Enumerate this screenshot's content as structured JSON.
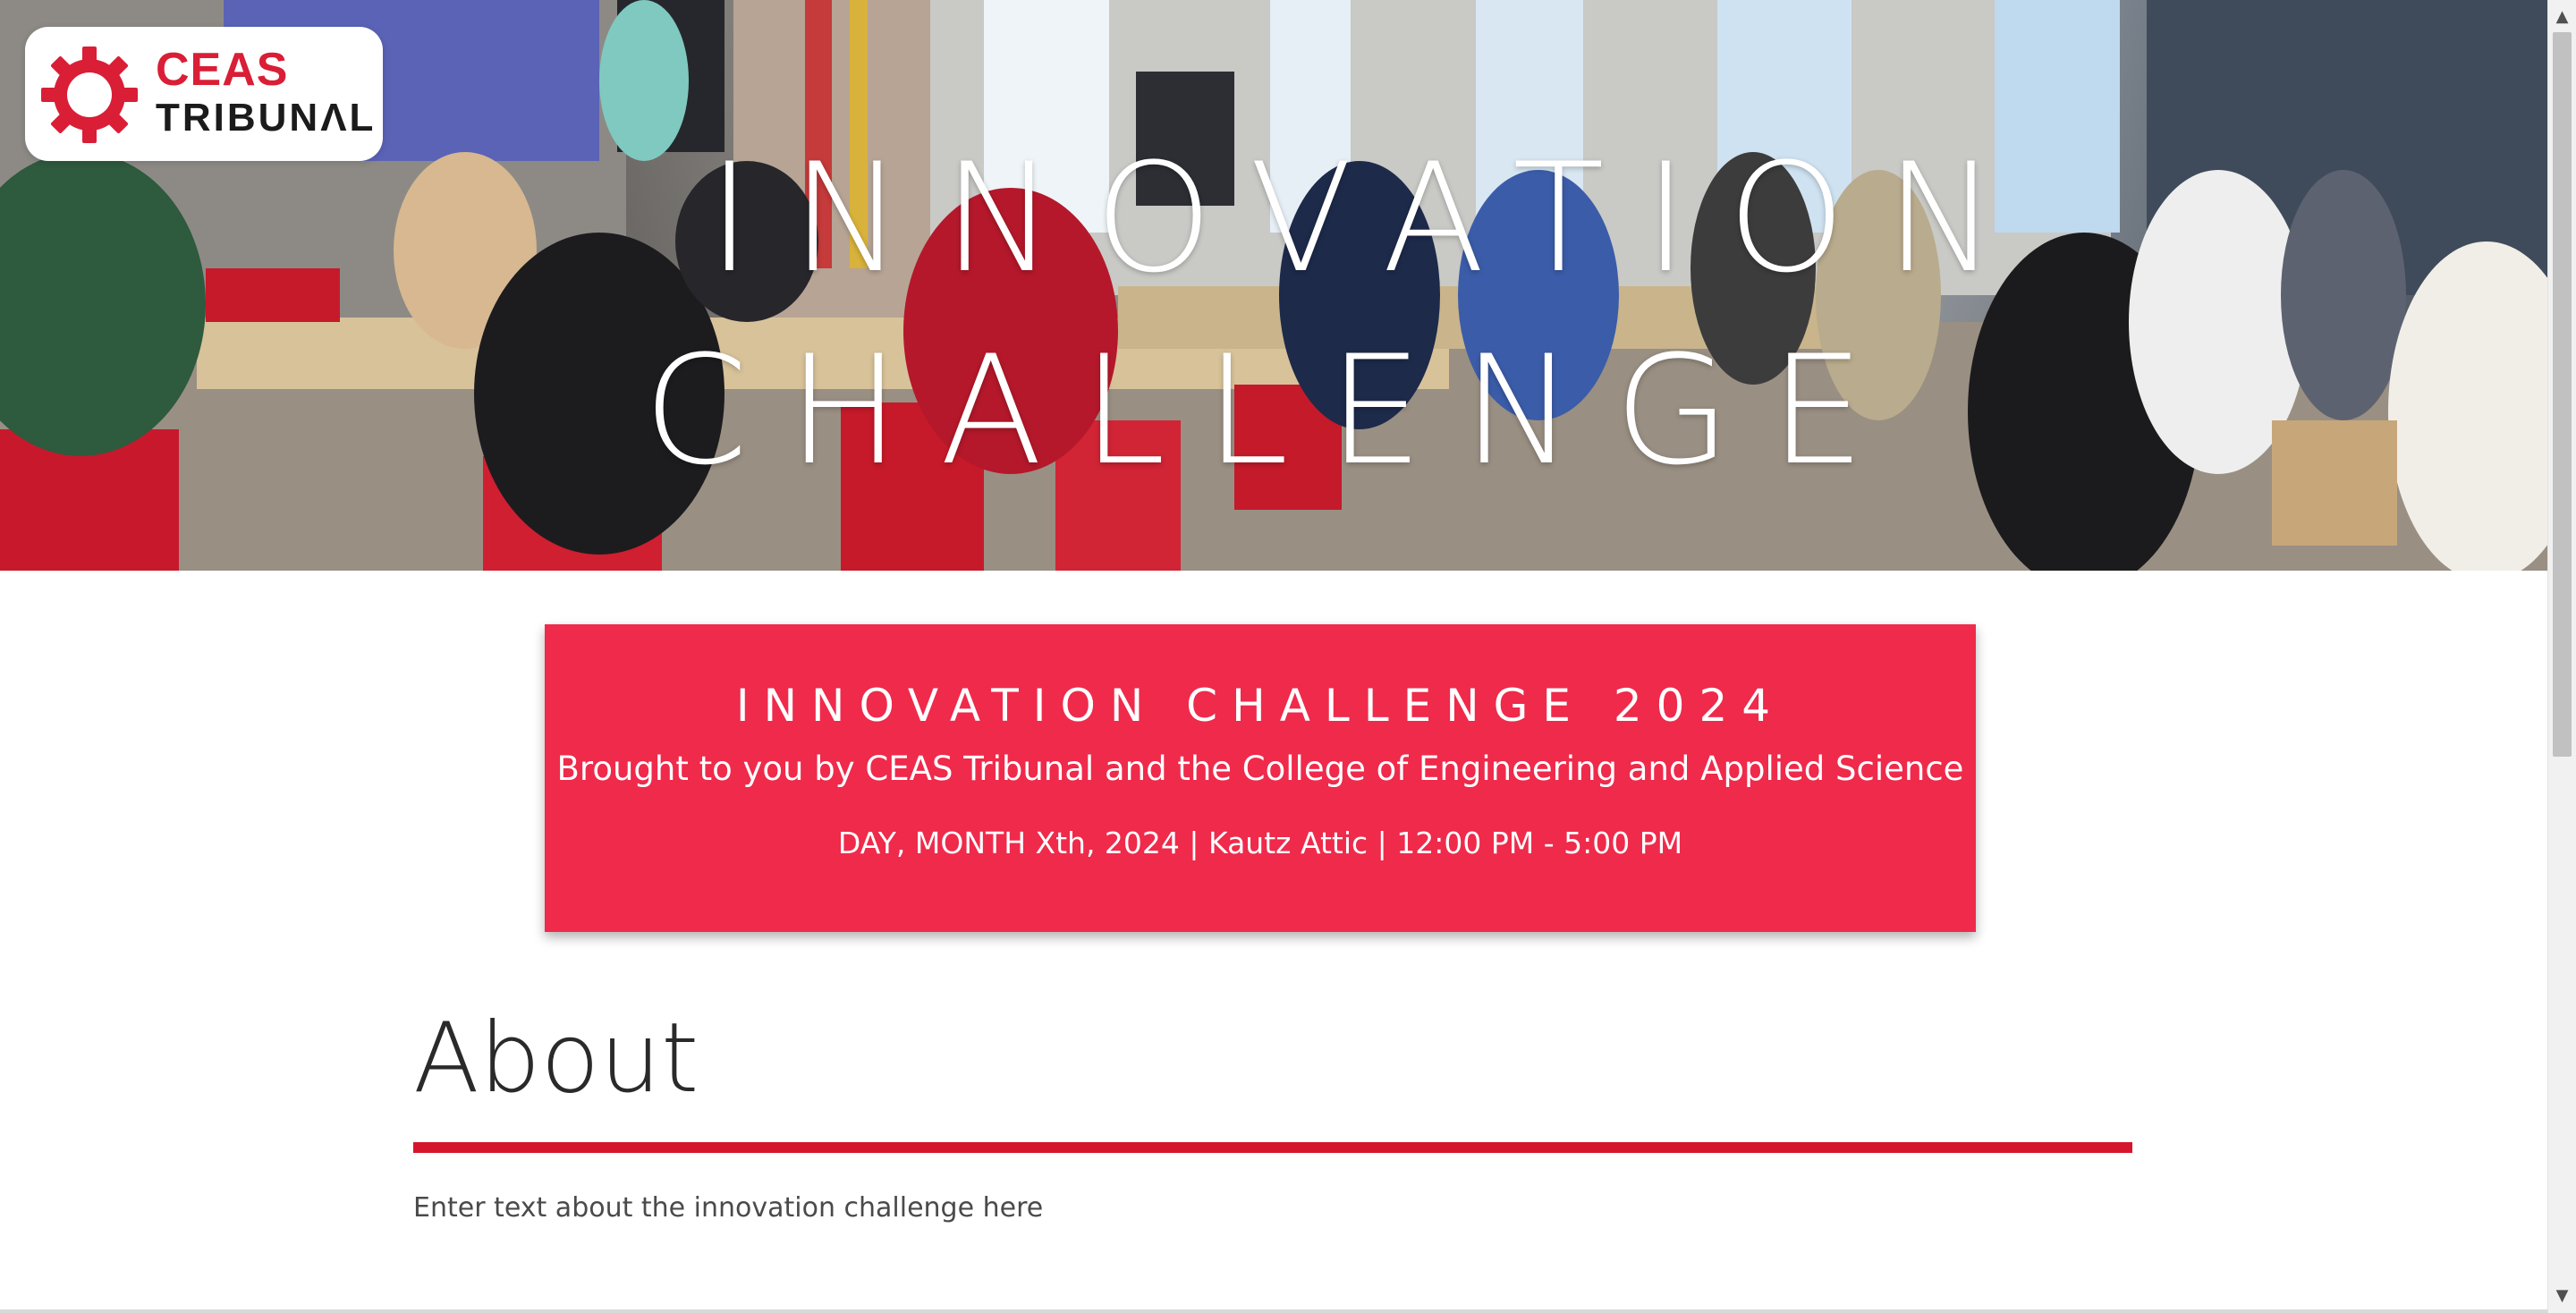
{
  "logo": {
    "line1": "CEAS",
    "line2": "TRIBUNΛL",
    "gear_color": "#d91e36"
  },
  "hero": {
    "title_line1": "INNOVATION",
    "title_line2": "CHALLENGE"
  },
  "info_box": {
    "title": "INNOVATION CHALLENGE 2024",
    "subtitle": "Brought to you by CEAS Tribunal and the College of Engineering and Applied Science",
    "meta": "DAY, MONTH Xth, 2024 | Kautz Attic | 12:00 PM - 5:00 PM",
    "background": "#ef2a4b"
  },
  "about": {
    "heading": "About",
    "text": "Enter text about the innovation challenge here",
    "rule_color": "#d7142d"
  },
  "scrollbar": {
    "up_icon": "chevron-up-icon",
    "down_icon": "chevron-down-icon"
  }
}
